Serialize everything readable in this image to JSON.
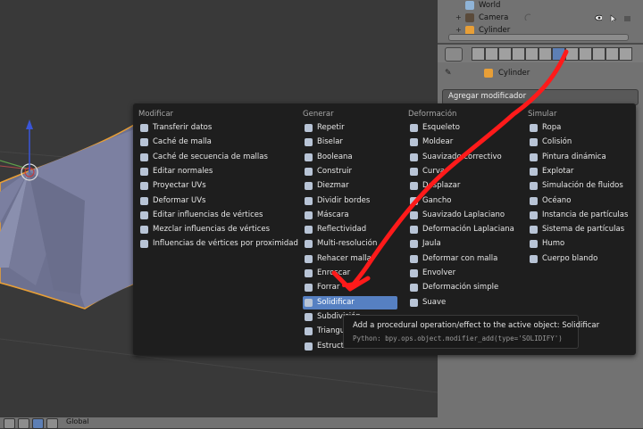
{
  "outliner": {
    "rows": [
      {
        "label": "World",
        "icon_color": "#8fb4d8"
      },
      {
        "label": "Camera",
        "icon_color": "#5a4a3a"
      },
      {
        "label": "Cylinder",
        "icon_color": "#e89f37"
      }
    ]
  },
  "breadcrumb": {
    "object": "Cylinder"
  },
  "add_modifier": {
    "label": "Agregar modificador"
  },
  "menu": {
    "columns": [
      {
        "header": "Modificar",
        "items": [
          "Transferir datos",
          "Caché de malla",
          "Caché de secuencia de mallas",
          "Editar normales",
          "Proyectar UVs",
          "Deformar UVs",
          "Editar influencias de vértices",
          "Mezclar influencias de vértices",
          "Influencias de vértices por proximidad"
        ]
      },
      {
        "header": "Generar",
        "items": [
          "Repetir",
          "Biselar",
          "Booleana",
          "Construir",
          "Diezmar",
          "Dividir bordes",
          "Máscara",
          "Reflectividad",
          "Multi-resolución",
          "Rehacer malla",
          "Enroscar",
          "Forrar",
          "Solidificar",
          "Subdivisión",
          "Triangular",
          "Estructura"
        ]
      },
      {
        "header": "Deformación",
        "items": [
          "Esqueleto",
          "Moldear",
          "Suavizado correctivo",
          "Curva",
          "Desplazar",
          "Gancho",
          "Suavizado Laplaciano",
          "Deformación Laplaciana",
          "Jaula",
          "Deformar con malla",
          "Envolver",
          "Deformación simple",
          "Suave"
        ]
      },
      {
        "header": "Simular",
        "items": [
          "Ropa",
          "Colisión",
          "Pintura dinámica",
          "Explotar",
          "Simulación de fluidos",
          "Océano",
          "Instancia de partículas",
          "Sistema de partículas",
          "Humo",
          "Cuerpo blando"
        ]
      }
    ],
    "highlighted": "Solidificar"
  },
  "tooltip": {
    "text": "Add a procedural operation/effect to the active object:",
    "value": "Solidificar",
    "python": "Python: bpy.ops.object.modifier_add(type='SOLIDIFY')"
  },
  "bottombar": {
    "orientation": "Global"
  },
  "colors": {
    "menu_bg": "#1e1e1e",
    "highlight": "#5680c2",
    "annotation_red": "#ff1a1a",
    "selection_orange": "#e89f37"
  }
}
